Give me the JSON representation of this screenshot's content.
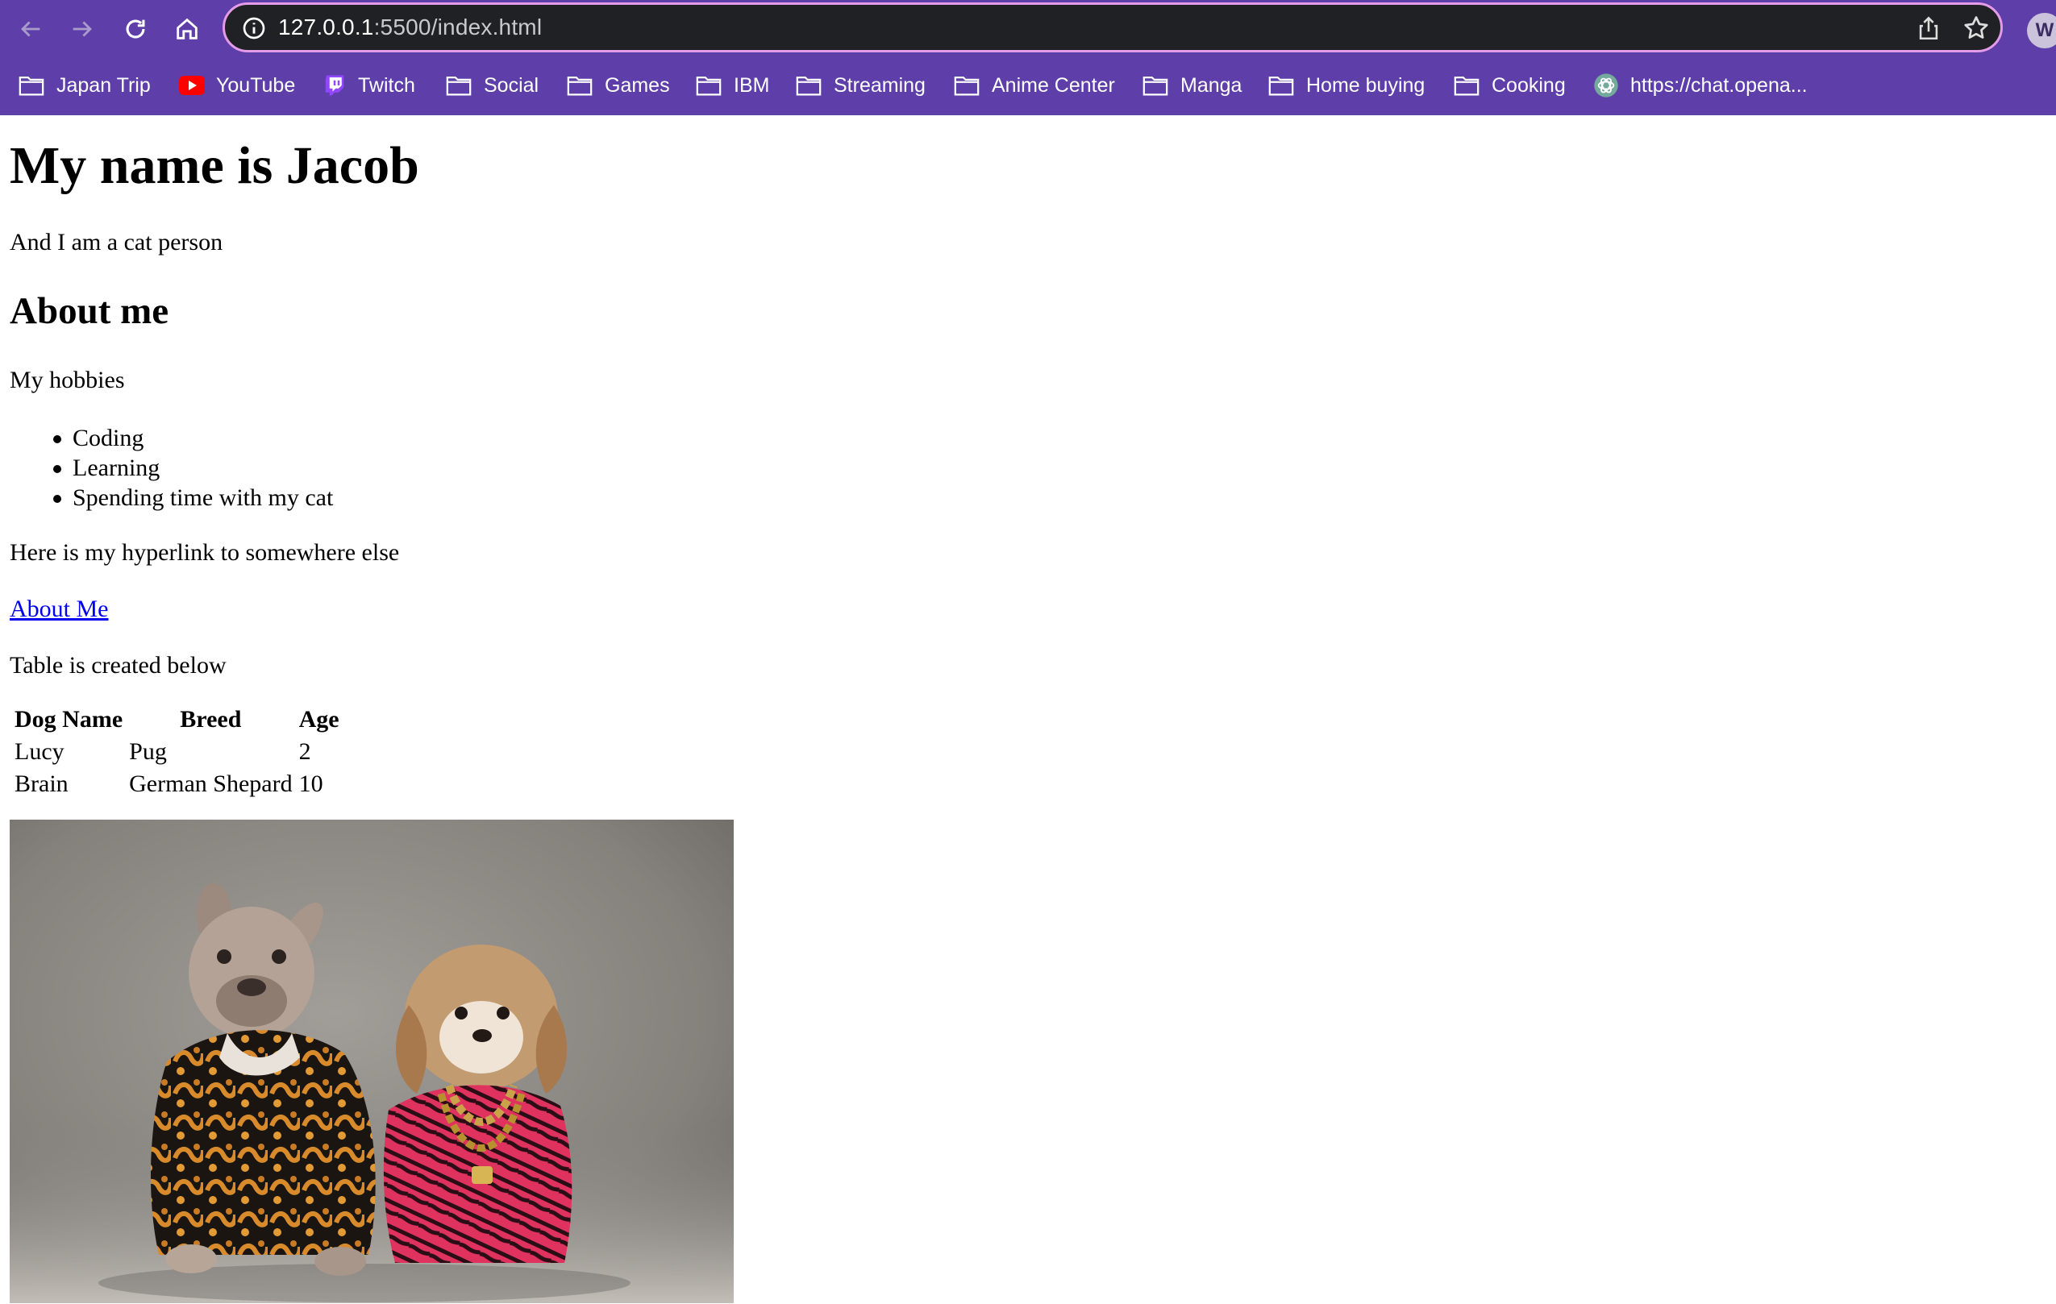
{
  "browser": {
    "url_host": "127.0.0.1",
    "url_rest": ":5500/index.html",
    "profile_initial": "W",
    "bookmarks": [
      {
        "label": "Japan Trip",
        "icon": "folder-icon"
      },
      {
        "label": "YouTube",
        "icon": "youtube-icon"
      },
      {
        "label": "Twitch",
        "icon": "twitch-icon"
      },
      {
        "label": "Social",
        "icon": "folder-icon"
      },
      {
        "label": "Games",
        "icon": "folder-icon"
      },
      {
        "label": "IBM",
        "icon": "folder-icon"
      },
      {
        "label": "Streaming",
        "icon": "folder-icon"
      },
      {
        "label": "Anime Center",
        "icon": "folder-icon"
      },
      {
        "label": "Manga",
        "icon": "folder-icon"
      },
      {
        "label": "Home buying",
        "icon": "folder-icon"
      },
      {
        "label": "Cooking",
        "icon": "folder-icon"
      },
      {
        "label": "https://chat.opena...",
        "icon": "openai-icon"
      }
    ],
    "colors": {
      "toolbar": "#5e3fa9",
      "omnibox": "#202124",
      "omnibox_border": "#e49be8"
    }
  },
  "page": {
    "heading": "My name is Jacob",
    "tagline": "And I am a cat person",
    "about_heading": "About me",
    "hobbies_label": "My hobbies",
    "hobbies": [
      "Coding",
      "Learning",
      "Spending time with my cat"
    ],
    "hyperlink_intro": "Here is my hyperlink to somewhere else",
    "link_text": "About Me",
    "table_intro": "Table is created below",
    "table": {
      "headers": [
        "Dog Name",
        "Breed",
        "Age"
      ],
      "rows": [
        [
          "Lucy",
          "Pug",
          "2"
        ],
        [
          "Brain",
          "German Shepard",
          "10"
        ]
      ]
    },
    "link_color": "#0000ee"
  }
}
